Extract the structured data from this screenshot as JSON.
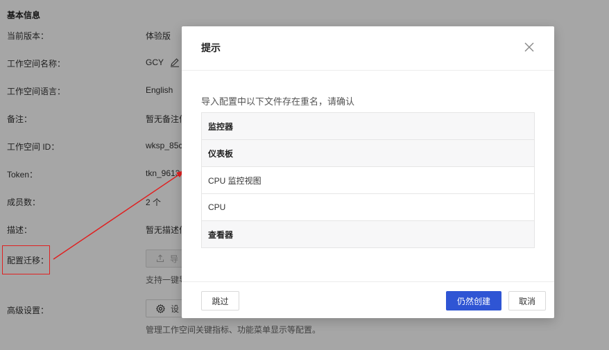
{
  "settings": {
    "section_title": "基本信息",
    "rows": [
      {
        "label": "当前版本：",
        "value": "体验版"
      },
      {
        "label": "工作空间名称：",
        "value": "GCY"
      },
      {
        "label": "工作空间语言：",
        "value": "English"
      },
      {
        "label": "备注：",
        "value": "暂无备注信"
      },
      {
        "label": "工作空间 ID：",
        "value": "wksp_85c"
      },
      {
        "label": "Token：",
        "value": "tkn_9613"
      },
      {
        "label": "成员数：",
        "value": "2 个"
      },
      {
        "label": "描述：",
        "value": "暂无描述信"
      }
    ],
    "migration": {
      "label": "配置迁移：",
      "button_label": "导",
      "hint": "支持一键导"
    },
    "advanced": {
      "label": "高级设置：",
      "button_label": "设",
      "hint": "管理工作空间关键指标、功能菜单显示等配置。"
    }
  },
  "modal": {
    "title": "提示",
    "message": "导入配置中以下文件存在重名，请确认",
    "items": [
      {
        "text": "监控器",
        "type": "group"
      },
      {
        "text": "仪表板",
        "type": "group"
      },
      {
        "text": "CPU 监控视图",
        "type": "item"
      },
      {
        "text": "CPU",
        "type": "item"
      },
      {
        "text": "查看器",
        "type": "group"
      }
    ],
    "buttons": {
      "skip": "跳过",
      "create": "仍然创建",
      "cancel": "取消"
    }
  },
  "colors": {
    "primary": "#2f55d4",
    "annotation": "#e02020"
  }
}
